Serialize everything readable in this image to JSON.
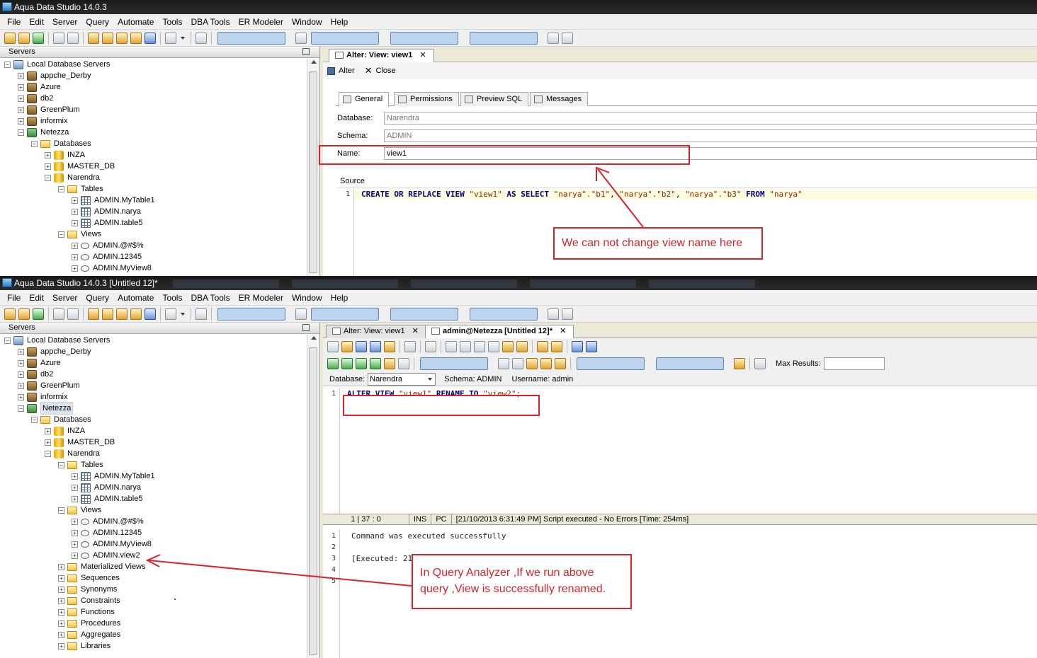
{
  "window1": {
    "title": "Aqua Data Studio 14.0.3",
    "servers_label": "Servers",
    "tab_label": "Alter: View: view1",
    "alter_label": "Alter",
    "close_label": "Close",
    "subtabs": [
      "General",
      "Permissions",
      "Preview SQL",
      "Messages"
    ],
    "database_label": "Database:",
    "database_value": "Narendra",
    "schema_label": "Schema:",
    "schema_value": "ADMIN",
    "name_label": "Name:",
    "name_value": "view1",
    "source_label": "Source",
    "line_number": "1",
    "sql_create": "CREATE",
    "sql_or": "OR",
    "sql_replace": "REPLACE",
    "sql_view": "VIEW",
    "sql_viewname": "\"view1\"",
    "sql_as": "AS",
    "sql_select": "SELECT",
    "sql_col1": "\"narya\".\"b1\"",
    "sql_col2": "\"narya\".\"b2\"",
    "sql_col3": "\"narya\".\"b3\"",
    "sql_from": "FROM",
    "sql_table": "\"narya\"",
    "tree": {
      "local": "Local Database Servers",
      "s1": "appche_Derby",
      "s2": "Azure",
      "s3": "db2",
      "s4": "GreenPlum",
      "s5": "informix",
      "s6": "Netezza",
      "databases": "Databases",
      "d1": "INZA",
      "d2": "MASTER_DB",
      "d3": "Narendra",
      "tables": "Tables",
      "t1": "ADMIN.MyTable1",
      "t2": "ADMIN.narya",
      "t3": "ADMIN.table5",
      "views": "Views",
      "v1": "ADMIN.@#$%",
      "v2": "ADMIN.12345",
      "v3": "ADMIN.MyView8"
    }
  },
  "window2": {
    "title": "Aqua Data Studio 14.0.3 [Untitled 12]*",
    "servers_label": "Servers",
    "tab1_label": "Alter: View: view1",
    "tab2_label": "admin@Netezza [Untitled 12]*",
    "max_results_label": "Max Results:",
    "database_label": "Database:",
    "database_value": "Narendra",
    "schema_text": "Schema:  ADMIN",
    "username_text": "Username:  admin",
    "line_number": "1",
    "sql_alter": "ALTER",
    "sql_view": "VIEW",
    "sql_old": "\"view1\"",
    "sql_rename": "RENAME",
    "sql_to": "TO",
    "sql_new": "\"view2\";",
    "status_pos": "1 | 37 : 0",
    "status_ins": "INS",
    "status_pc": "PC",
    "status_msg": "[21/10/2013 6:31:49 PM] Script executed - No Errors [Time: 254ms]",
    "results": [
      {
        "n": "1",
        "text": "Command was executed successfully"
      },
      {
        "n": "2",
        "text": ""
      },
      {
        "n": "3",
        "text": "[Executed: 21/10/2013 6:31:48 PM] [Execution: 24ms]"
      },
      {
        "n": "4",
        "text": ""
      },
      {
        "n": "5",
        "text": ""
      }
    ],
    "tree": {
      "local": "Local Database Servers",
      "s1": "appche_Derby",
      "s2": "Azure",
      "s3": "db2",
      "s4": "GreenPlum",
      "s5": "informix",
      "s6": "Netezza",
      "databases": "Databases",
      "d1": "INZA",
      "d2": "MASTER_DB",
      "d3": "Narendra",
      "tables": "Tables",
      "t1": "ADMIN.MyTable1",
      "t2": "ADMIN.narya",
      "t3": "ADMIN.table5",
      "views": "Views",
      "v1": "ADMIN.@#$%",
      "v2": "ADMIN.12345",
      "v3": "ADMIN.MyView8",
      "v4": "ADMIN.view2",
      "f1": "Materialized Views",
      "f2": "Sequences",
      "f3": "Synonyms",
      "f4": "Constraints",
      "f5": "Functions",
      "f6": "Procedures",
      "f7": "Aggregates",
      "f8": "Libraries"
    }
  },
  "menu": [
    "File",
    "Edit",
    "Server",
    "Query",
    "Automate",
    "Tools",
    "DBA Tools",
    "ER Modeler",
    "Window",
    "Help"
  ],
  "annotations": {
    "top": "We can not change view name here",
    "bottom_line1": "In Query Analyzer ,If we run above",
    "bottom_line2": "query ,View is successfully renamed."
  },
  "colors": {
    "annotation": "#d9232a",
    "keyword": "#000080",
    "string": "#8b2500"
  }
}
